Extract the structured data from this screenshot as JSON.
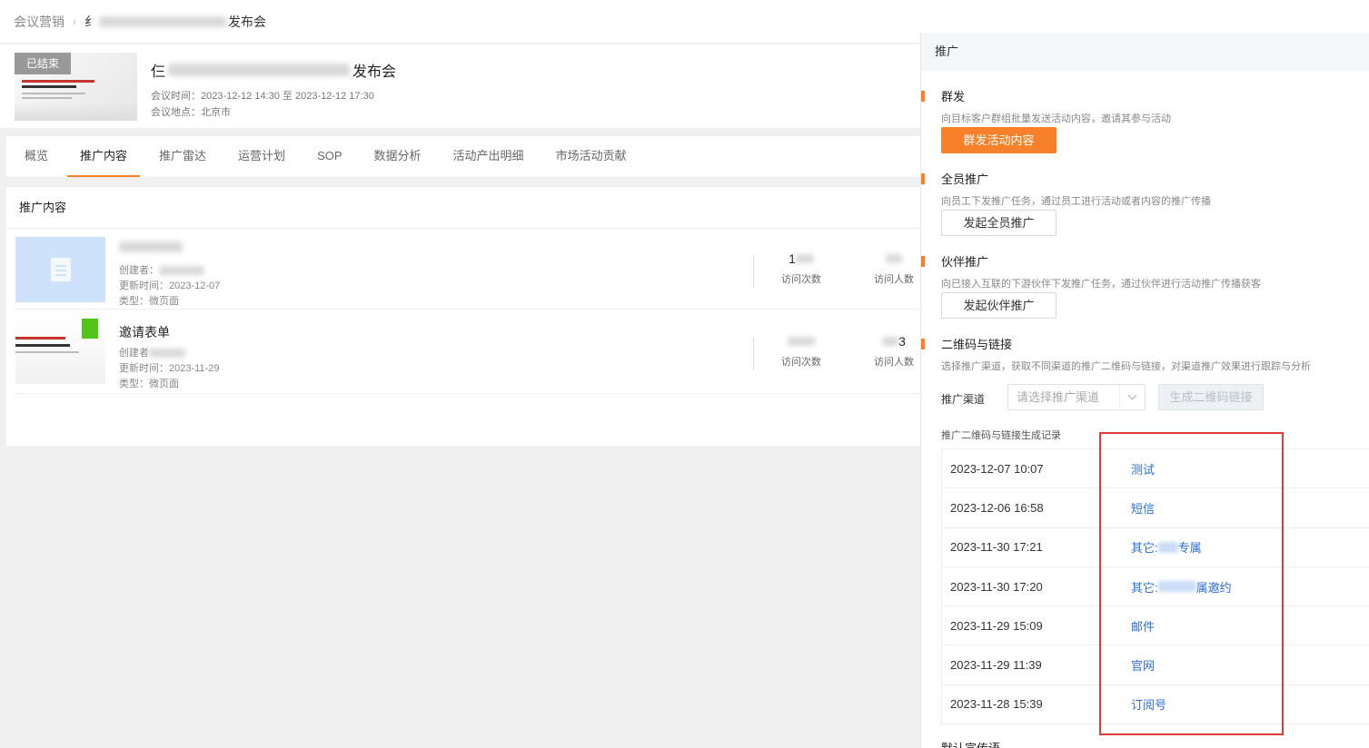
{
  "breadcrumb": {
    "root": "会议营销",
    "current_prefix": "纟",
    "current_suffix": "发布会"
  },
  "event": {
    "badge": "已结束",
    "title_prefix": "仨",
    "title_suffix": "发布会",
    "time_label": "会议时间：",
    "time_value": "2023-12-12 14:30 至 2023-12-12 17:30",
    "place_label": "会议地点：",
    "place_value": "北京市"
  },
  "tabs": [
    {
      "label": "概览",
      "active": false
    },
    {
      "label": "推广内容",
      "active": true
    },
    {
      "label": "推广雷达",
      "active": false
    },
    {
      "label": "运营计划",
      "active": false
    },
    {
      "label": "SOP",
      "active": false
    },
    {
      "label": "数据分析",
      "active": false
    },
    {
      "label": "活动产出明细",
      "active": false
    },
    {
      "label": "市场活动贡献",
      "active": false
    }
  ],
  "content": {
    "header": "推广内容",
    "items": [
      {
        "title": "",
        "creator_label": "创建者：",
        "updated_label": "更新时间：",
        "updated": "2023-12-07",
        "type_label": "类型：",
        "type": "微页面",
        "visits_num": "1",
        "visits_label": "访问次数",
        "visitors_num": "",
        "visitors_label": "访问人数"
      },
      {
        "title": "邀请表单",
        "creator_label": "创建者",
        "updated_label": "更新时间：",
        "updated": "2023-11-29",
        "type_label": "类型：",
        "type": "微页面",
        "visits_num": "",
        "visits_label": "访问次数",
        "visitors_num": "3",
        "visitors_label": "访问人数"
      }
    ]
  },
  "panel": {
    "header": "推广",
    "mass_send": {
      "title": "群发",
      "desc": "向目标客户群组批量发送活动内容，邀请其参与活动",
      "button": "群发活动内容"
    },
    "all_staff": {
      "title": "全员推广",
      "desc": "向员工下发推广任务，通过员工进行活动或者内容的推广传播",
      "button": "发起全员推广"
    },
    "partner": {
      "title": "伙伴推广",
      "desc": "向已接入互联的下游伙伴下发推广任务，通过伙伴进行活动推广传播获客",
      "button": "发起伙伴推广"
    },
    "qr": {
      "title": "二维码与链接",
      "desc": "选择推广渠道，获取不同渠道的推广二维码与链接，对渠道推广效果进行跟踪与分析",
      "channel_label": "推广渠道",
      "channel_placeholder": "请选择推广渠道",
      "generate_button": "生成二维码链接",
      "records_title": "推广二维码与链接生成记录",
      "records": [
        {
          "time": "2023-12-07 10:07",
          "channel": "测试",
          "channel_tail": ""
        },
        {
          "time": "2023-12-06 16:58",
          "channel": "短信",
          "channel_tail": ""
        },
        {
          "time": "2023-11-30 17:21",
          "channel": "其它:",
          "channel_tail": "专属"
        },
        {
          "time": "2023-11-30 17:20",
          "channel": "其它:",
          "channel_tail": "属邀约"
        },
        {
          "time": "2023-11-29 15:09",
          "channel": "邮件",
          "channel_tail": ""
        },
        {
          "time": "2023-11-29 11:39",
          "channel": "官网",
          "channel_tail": ""
        },
        {
          "time": "2023-11-28 15:39",
          "channel": "订阅号",
          "channel_tail": ""
        }
      ]
    },
    "next_section_cut": "默认宣传语"
  },
  "colors": {
    "accent": "#f7812a",
    "link": "#2d6fd6",
    "highlight_box": "#e03a3a",
    "badge_gray": "#999999"
  }
}
